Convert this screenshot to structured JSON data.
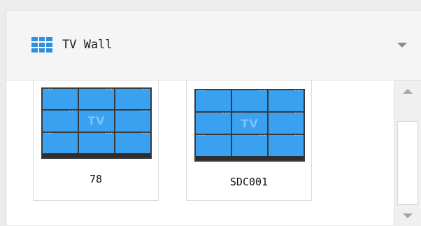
{
  "header": {
    "title": "TV Wall",
    "icon": "tv-wall-grid-icon",
    "dropdown_icon": "chevron-down-icon"
  },
  "colors": {
    "screen_cell": "#3aa0f0",
    "screen_frame": "#3a3a3a",
    "icon_blue": "#2e8ee0"
  },
  "walls": [
    {
      "name": "78",
      "screen_text": "TV",
      "icon": "tv-wall-thumbnail-icon"
    },
    {
      "name": "SDC001",
      "screen_text": "TV",
      "icon": "tv-wall-thumbnail-icon"
    }
  ],
  "scrollbar": {
    "up_icon": "scroll-up-arrow-icon",
    "down_icon": "scroll-down-arrow-icon"
  }
}
